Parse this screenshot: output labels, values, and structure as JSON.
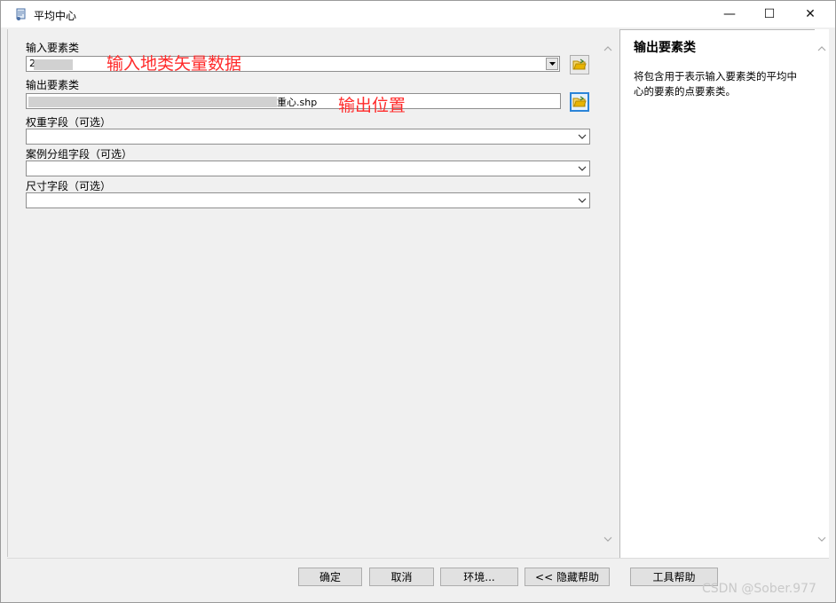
{
  "window": {
    "title": "平均中心",
    "minimize": "—",
    "maximize": "☐",
    "close": "✕"
  },
  "fields": {
    "input_features": {
      "label": "输入要素类",
      "value": "2"
    },
    "output_features": {
      "label": "输出要素类",
      "value_suffix": "重心.shp"
    },
    "weight_field": {
      "label": "权重字段（可选）",
      "value": ""
    },
    "case_field": {
      "label": "案例分组字段（可选）",
      "value": ""
    },
    "dimension_field": {
      "label": "尺寸字段（可选）",
      "value": ""
    }
  },
  "annotations": {
    "input_note": "输入地类矢量数据",
    "output_note": "输出位置"
  },
  "help": {
    "title": "输出要素类",
    "body": "将包含用于表示输入要素类的平均中心的要素的点要素类。"
  },
  "buttons": {
    "ok": "确定",
    "cancel": "取消",
    "environments": "环境...",
    "hide_help": "<< 隐藏帮助",
    "tool_help": "工具帮助"
  },
  "watermark": "CSDN @Sober.977",
  "colors": {
    "annotation": "#ff2b2b",
    "focus": "#2b84d8",
    "folder": "#e8b400"
  }
}
